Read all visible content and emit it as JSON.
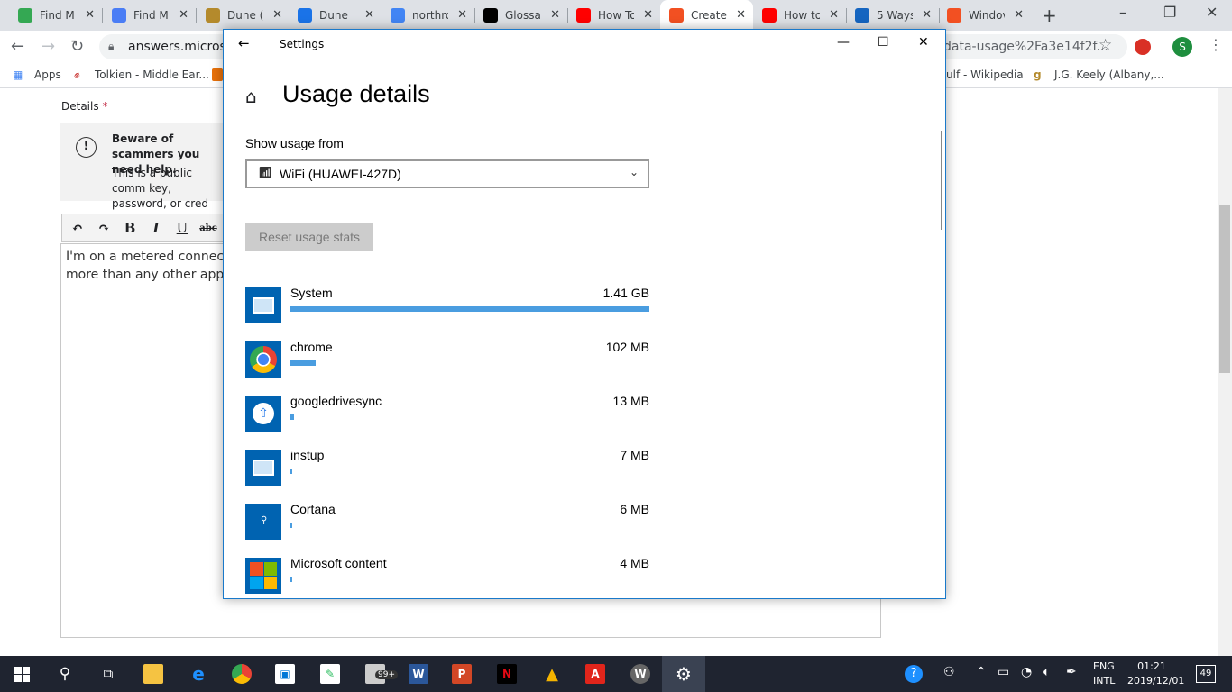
{
  "browser": {
    "tabs": [
      {
        "title": "Find M",
        "icon": "green-circle",
        "color": "#34a853"
      },
      {
        "title": "Find M",
        "icon": "blue-square",
        "color": "#4a7df5"
      },
      {
        "title": "Dune (",
        "icon": "goodreads",
        "color": "#b48a2c"
      },
      {
        "title": "Dune",
        "icon": "globe",
        "color": "#1a73e8"
      },
      {
        "title": "northro",
        "icon": "google",
        "color": "#4285f4"
      },
      {
        "title": "Glossar",
        "icon": "wikipedia",
        "color": "#000000"
      },
      {
        "title": "How To",
        "icon": "youtube",
        "color": "#ff0000"
      },
      {
        "title": "Create",
        "icon": "microsoft",
        "color": "#f25022"
      },
      {
        "title": "How to",
        "icon": "youtube",
        "color": "#ff0000"
      },
      {
        "title": "5 Ways",
        "icon": "s-logo",
        "color": "#1565c0"
      },
      {
        "title": "Windov",
        "icon": "microsoft",
        "color": "#f25022"
      }
    ],
    "url_left": "answers.microsof",
    "url_right": "data-usage%2Fa3e14f2f...",
    "bookmarks": [
      "Apps",
      "Tolkien - Middle Ear...",
      "ulf - Wikipedia",
      "J.G. Keely (Albany,..."
    ],
    "profile_initial": "S"
  },
  "page": {
    "details_label": "Details",
    "required_mark": "*",
    "warning_title": "Beware of scammers you need help.",
    "warning_body": "This is a public comm key, password, or cred",
    "editor_text_line1": "I'm on a metered connecti",
    "editor_text_line2": "more than any other app ("
  },
  "settings": {
    "window_title": "Settings",
    "heading": "Usage details",
    "show_from_label": "Show usage from",
    "network": "WiFi (HUAWEI-427D)",
    "reset_button": "Reset usage stats",
    "apps": [
      {
        "name": "System",
        "size": "1.41 GB",
        "fraction": 1.0,
        "icon": "system-icon",
        "icon_color": "#0063b1"
      },
      {
        "name": "chrome",
        "size": "102 MB",
        "fraction": 0.07,
        "icon": "chrome-icon",
        "icon_color": "#0063b1"
      },
      {
        "name": "googledrivesync",
        "size": "13 MB",
        "fraction": 0.009,
        "icon": "google-drive-icon",
        "icon_color": "#0063b1"
      },
      {
        "name": "instup",
        "size": "7 MB",
        "fraction": 0.005,
        "icon": "system-icon",
        "icon_color": "#0063b1"
      },
      {
        "name": "Cortana",
        "size": "6 MB",
        "fraction": 0.004,
        "icon": "cortana-icon",
        "icon_color": "#0063b1"
      },
      {
        "name": "Microsoft content",
        "size": "4 MB",
        "fraction": 0.003,
        "icon": "microsoft-icon",
        "icon_color": "#0063b1"
      }
    ],
    "accent_color": "#4a9de0"
  },
  "taskbar": {
    "badge_count": "99+",
    "language": "ENG",
    "layout": "INTL",
    "time": "01:21",
    "date": "2019/12/01",
    "notifications": "49"
  }
}
